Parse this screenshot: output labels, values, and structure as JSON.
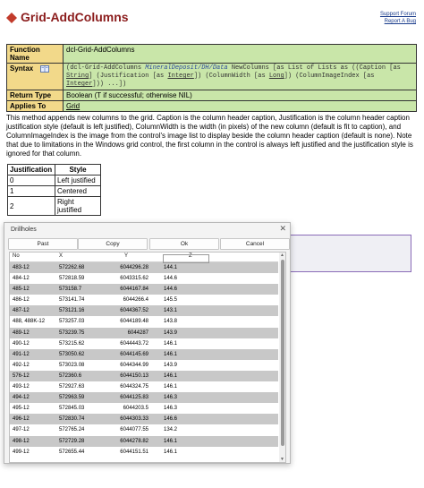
{
  "header": {
    "title": "Grid-AddColumns",
    "support_link": "Support Forum",
    "report_link": "Report A Bug"
  },
  "info": {
    "function_name_label": "Function Name",
    "function_name": "dcl-Grid-AddColumns",
    "syntax_label": "Syntax",
    "syntax_parts": {
      "p1": "(dcl-Grid-AddColumns ",
      "p2": "MineralDeposit/DH/Data",
      "p3": " NewColumns [as List of Lists as ((Caption [as ",
      "p4": "String",
      "p5": "] (Justification [as ",
      "p6": "Integer",
      "p7": "]) (ColumnWidth [as ",
      "p8": "Long",
      "p9": "]) (ColumnImageIndex [as ",
      "p10": "Integer",
      "p11": "])) ...])"
    },
    "return_type_label": "Return Type",
    "return_type": "Boolean (T if successful; otherwise NIL)",
    "applies_to_label": "Applies To",
    "applies_to": "Grid"
  },
  "description": "This method appends new columns to the grid. Caption is the column header caption, Justification is the column header caption justification style (default is left justified), ColumnWidth is the width (in pixels) of the new column (default is fit to caption), and ColumnImageIndex is the image from the control's image list to display beside the column header caption (default is none). Note that due to limitations in the Windows grid control, the first column in the control is always left justified and the justification style is ignored for that column.",
  "justification_table": {
    "headers": [
      "Justification",
      "Style"
    ],
    "rows": [
      [
        "0",
        "Left justified"
      ],
      [
        "1",
        "Centered"
      ],
      [
        "2",
        "Right justified"
      ]
    ]
  },
  "dialog": {
    "title": "Drillholes",
    "close_glyph": "✕",
    "buttons": {
      "past": "Past",
      "copy": "Copy",
      "ok": "Ok",
      "cancel": "Cancel"
    },
    "columns": [
      "No",
      "X",
      "Y",
      "Z"
    ],
    "rows": [
      [
        "483-12",
        "572262.68",
        "6044296.28",
        "144.1"
      ],
      [
        "484-12",
        "572818.59",
        "6043315.62",
        "144.6"
      ],
      [
        "485-12",
        "573158.7",
        "6044167.84",
        "144.6"
      ],
      [
        "486-12",
        "573141.74",
        "6044266.4",
        "145.5"
      ],
      [
        "487-12",
        "573121.16",
        "6044367.52",
        "143.1"
      ],
      [
        "488, 488K-12",
        "573257.03",
        "6044189.48",
        "143.8"
      ],
      [
        "489-12",
        "573239.75",
        "6044287",
        "143.9"
      ],
      [
        "490-12",
        "573215.62",
        "6044443.72",
        "146.1"
      ],
      [
        "491-12",
        "573050.62",
        "6044145.69",
        "146.1"
      ],
      [
        "492-12",
        "573023.08",
        "6044344.99",
        "143.9"
      ],
      [
        "576-12",
        "572360.6",
        "6044150.13",
        "146.1"
      ],
      [
        "493-12",
        "572927.63",
        "6044324.75",
        "146.1"
      ],
      [
        "494-12",
        "572963.59",
        "6044125.83",
        "146.3"
      ],
      [
        "495-12",
        "572845.03",
        "6044203.5",
        "146.3"
      ],
      [
        "496-12",
        "572830.74",
        "6044303.33",
        "146.6"
      ],
      [
        "497-12",
        "572765.24",
        "6044077.55",
        "134.2"
      ],
      [
        "498-12",
        "572729.28",
        "6044278.82",
        "146.1"
      ],
      [
        "499-12",
        "572655.44",
        "6044151.51",
        "146.1"
      ]
    ]
  }
}
